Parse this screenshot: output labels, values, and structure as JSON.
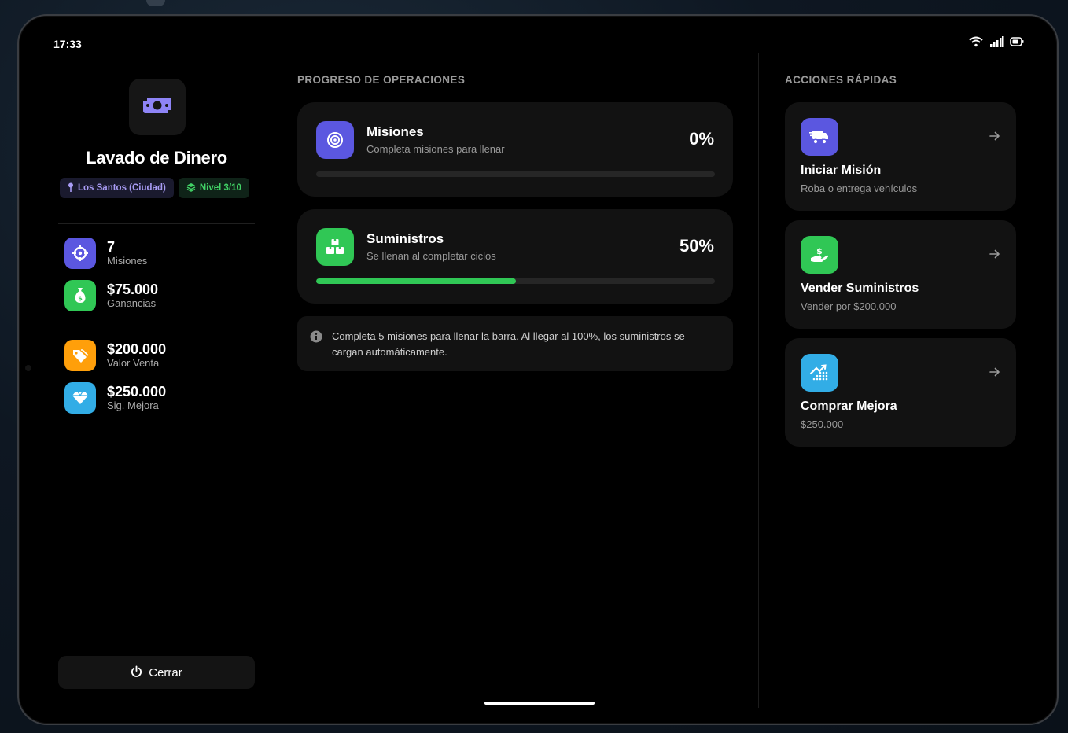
{
  "status_bar": {
    "time": "17:33"
  },
  "sidebar": {
    "title": "Lavado de Dinero",
    "location_badge": "Los Santos (Ciudad)",
    "level_badge": "Nivel 3/10",
    "stats": [
      {
        "value": "7",
        "label": "Misiones",
        "icon": "crosshair-icon",
        "color": "#5b57e0"
      },
      {
        "value": "$75.000",
        "label": "Ganancias",
        "icon": "money-bag-icon",
        "color": "#30c755"
      },
      {
        "value": "$200.000",
        "label": "Valor Venta",
        "icon": "tags-icon",
        "color": "#ff9f0a"
      },
      {
        "value": "$250.000",
        "label": "Sig. Mejora",
        "icon": "diamond-icon",
        "color": "#32ade6"
      }
    ],
    "close_label": "Cerrar"
  },
  "progress": {
    "section_title": "PROGRESO DE OPERACIONES",
    "cards": [
      {
        "name": "Misiones",
        "desc": "Completa misiones para llenar",
        "percent_label": "0%",
        "progress": 0,
        "icon": "target-icon",
        "color": "#5b57e0"
      },
      {
        "name": "Suministros",
        "desc": "Se llenan al completar ciclos",
        "percent_label": "50%",
        "progress": 0.5,
        "icon": "boxes-icon",
        "color": "#30c755"
      }
    ],
    "info": "Completa 5 misiones para llenar la barra. Al llegar al 100%, los suministros se cargan automáticamente."
  },
  "actions": {
    "section_title": "ACCIONES RÁPIDAS",
    "items": [
      {
        "name": "Iniciar Misión",
        "sub": "Roba o entrega vehículos",
        "icon": "truck-icon",
        "color": "#5b57e0"
      },
      {
        "name": "Vender Suministros",
        "sub": "Vender por $200.000",
        "icon": "hand-dollar-icon",
        "color": "#30c755"
      },
      {
        "name": "Comprar Mejora",
        "sub": "$250.000",
        "icon": "chart-up-icon",
        "color": "#32ade6"
      }
    ]
  },
  "colors": {
    "accent_purple": "#5b57e0",
    "accent_green": "#30c755",
    "accent_orange": "#ff9f0a",
    "accent_blue": "#32ade6"
  }
}
